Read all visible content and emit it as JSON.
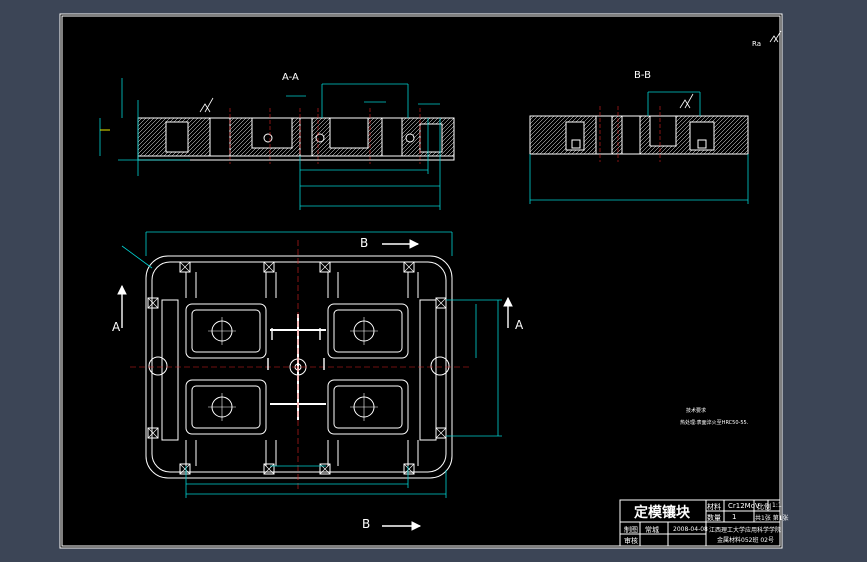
{
  "colors": {
    "background": "#3c4556",
    "sheet": "#000000",
    "line": "#ffffff",
    "dimension": "#00d2d2",
    "centerline": "#e02020",
    "tolerance": "#e8e800"
  },
  "views": {
    "section_aa": "A-A",
    "section_bb": "B-B",
    "cut_a": "A",
    "cut_b": "B"
  },
  "roughness_note": "Ra",
  "technical_requirements": {
    "title": "技术要求",
    "item": "热处理:表面淬火至HRC50-55."
  },
  "title_block": {
    "part_name": "定模镶块",
    "material_label": "材料",
    "material_value": "Cr12MoV",
    "scale_label": "比例",
    "scale_value": "1:1",
    "quantity_label": "数量",
    "quantity_value": "1",
    "sheets_label": "共1张 第1张",
    "designer_label": "制图",
    "designer_name": "常城",
    "date": "2008-04-08",
    "checker_label": "审核",
    "school": "江西理工大学应用科学学院",
    "class_info": "金属材料052班  02号"
  }
}
